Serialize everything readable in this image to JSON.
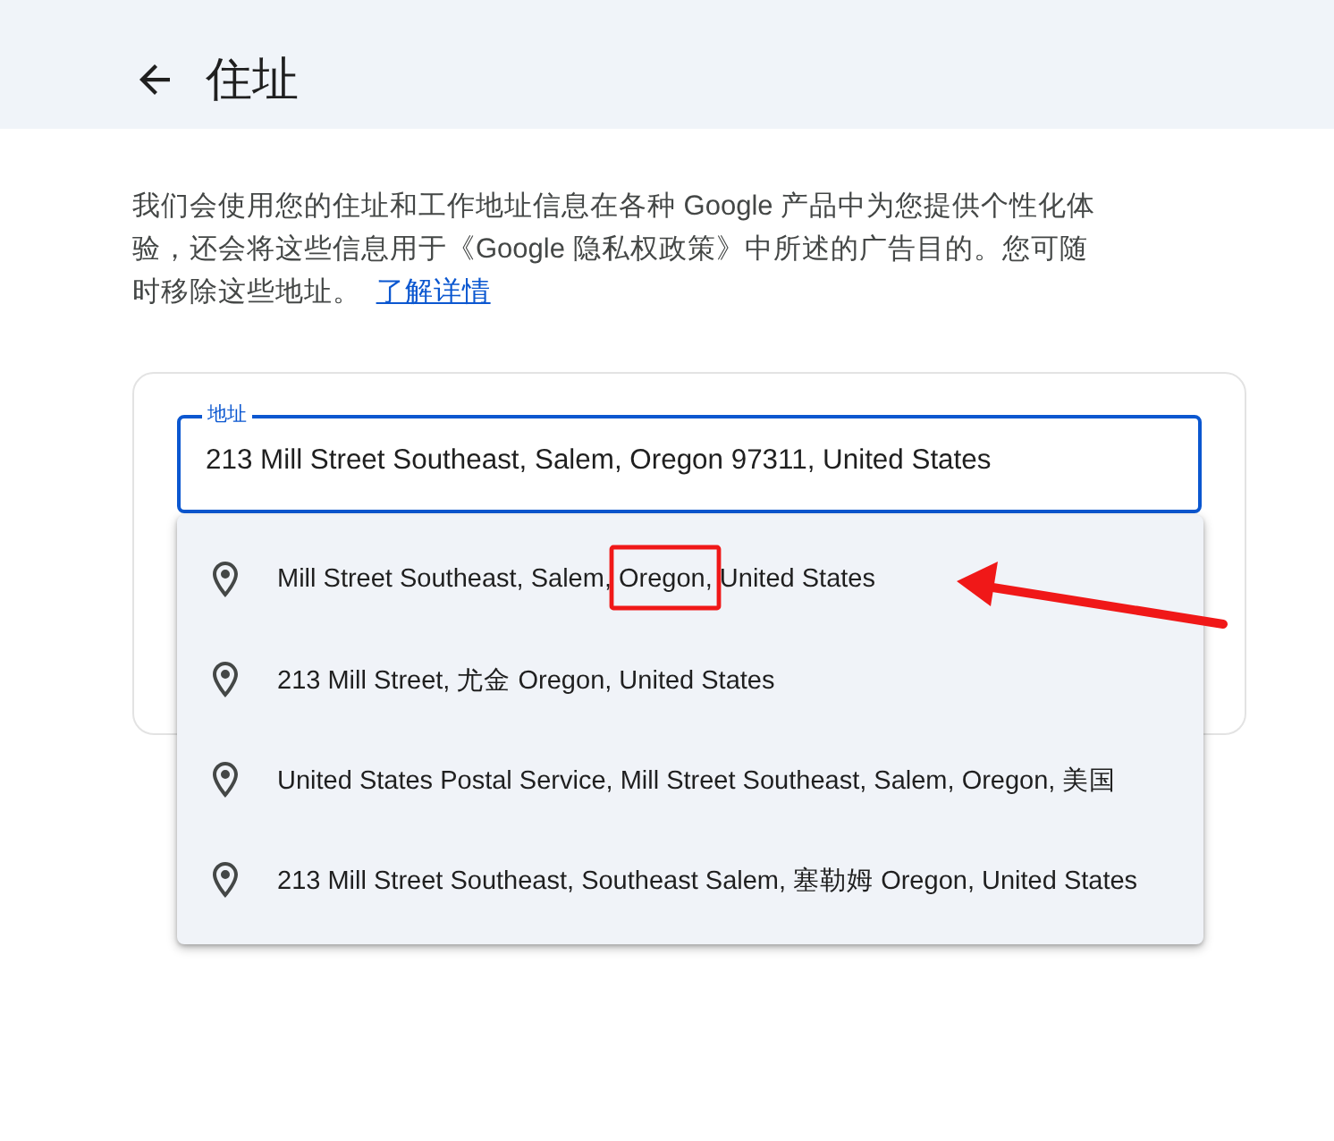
{
  "header": {
    "title": "住址"
  },
  "description": {
    "text": "我们会使用您的住址和工作地址信息在各种 Google 产品中为您提供个性化体验，还会将这些信息用于《Google 隐私权政策》中所述的广告目的。您可随时移除这些地址。",
    "link": "了解详情"
  },
  "address_field": {
    "label": "地址",
    "value": "213 Mill Street Southeast, Salem, Oregon 97311, United States",
    "focused": true
  },
  "suggestions": [
    {
      "text": "Mill Street Southeast, Salem, Oregon, United States"
    },
    {
      "text": "213 Mill Street, 尤金 Oregon, United States"
    },
    {
      "text": "United States Postal Service, Mill Street Southeast, Salem, Oregon, 美国"
    },
    {
      "text": "213 Mill Street Southeast, Southeast Salem, 塞勒姆 Oregon, United States"
    }
  ],
  "annotations": {
    "highlight_frame": true,
    "arrow": true
  }
}
